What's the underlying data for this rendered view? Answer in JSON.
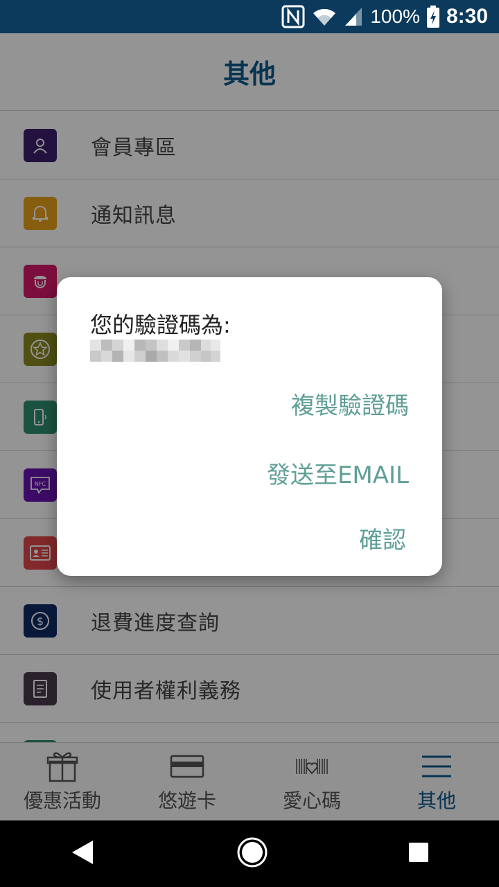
{
  "status_bar": {
    "battery": "100%",
    "time": "8:30"
  },
  "header": {
    "title": "其他"
  },
  "menu": {
    "items": [
      {
        "label": "會員專區",
        "icon": "user-icon",
        "color": "#3d1f6e"
      },
      {
        "label": "通知訊息",
        "icon": "bell-icon",
        "color": "#e8a21a"
      },
      {
        "label": "",
        "icon": "acorn-icon",
        "color": "#d6196a"
      },
      {
        "label": "",
        "icon": "star-icon",
        "color": "#8b8a22"
      },
      {
        "label": "",
        "icon": "phone-icon",
        "color": "#2f8f73"
      },
      {
        "label": "",
        "icon": "nfc-icon",
        "color": "#6a14b2"
      },
      {
        "label": "",
        "icon": "id-card-icon",
        "color": "#e2474a"
      },
      {
        "label": "退費進度查詢",
        "icon": "dollar-icon",
        "color": "#0d2a63"
      },
      {
        "label": "使用者權利義務",
        "icon": "document-icon",
        "color": "#4a3a4f"
      },
      {
        "label": "",
        "icon": "more-icon",
        "color": "#2f8f73"
      }
    ]
  },
  "bottom_nav": {
    "items": [
      {
        "label": "優惠活動",
        "icon": "gift-icon"
      },
      {
        "label": "悠遊卡",
        "icon": "card-icon"
      },
      {
        "label": "愛心碼",
        "icon": "barcode-heart-icon"
      },
      {
        "label": "其他",
        "icon": "menu-icon"
      }
    ],
    "active_index": 3
  },
  "dialog": {
    "title": "您的驗證碼為:",
    "copy_label": "複製驗證碼",
    "email_label": "發送至EMAIL",
    "confirm_label": "確認",
    "accent_color": "#5f9f96"
  }
}
